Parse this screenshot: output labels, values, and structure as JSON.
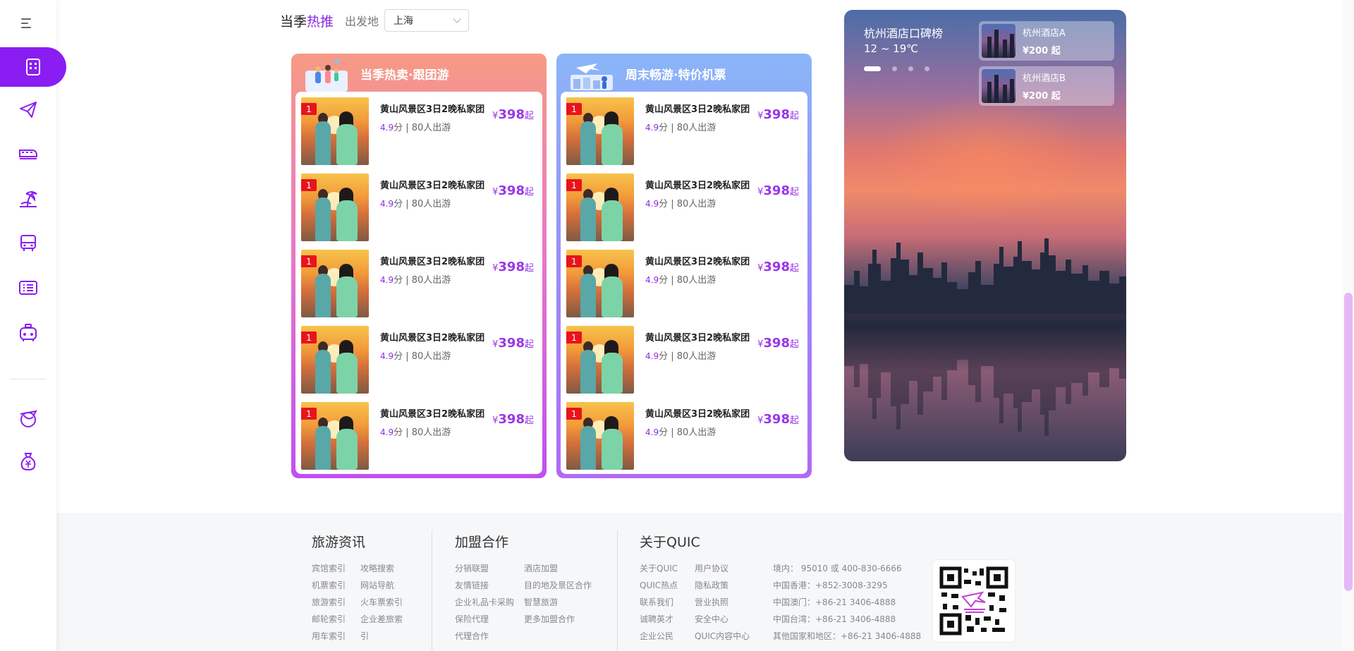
{
  "nav": {
    "items": [
      {
        "icon": "hotel-icon",
        "active": true
      },
      {
        "icon": "flight-icon",
        "active": false
      },
      {
        "icon": "train-icon",
        "active": false
      },
      {
        "icon": "vacation-icon",
        "active": false
      },
      {
        "icon": "bus-icon",
        "active": false
      },
      {
        "icon": "ticket-list-icon",
        "active": false
      },
      {
        "icon": "taxi-icon",
        "active": false
      },
      {
        "icon": "visa-icon",
        "active": false
      },
      {
        "icon": "money-bag-icon",
        "active": false
      }
    ],
    "accent": "#8a1df2"
  },
  "section": {
    "title_prefix": "当季",
    "title_highlight": "热推",
    "depart_label": "出发地",
    "depart_value": "上海"
  },
  "cards": [
    {
      "title": "当季热卖·跟团游",
      "items": [
        {
          "rank": "1",
          "name": "黄山风景区3日2晚私家团",
          "score": "4.9",
          "score_unit": "分",
          "travelers": "| 80人出游",
          "currency": "¥",
          "price": "398",
          "price_suffix": "起"
        },
        {
          "rank": "1",
          "name": "黄山风景区3日2晚私家团",
          "score": "4.9",
          "score_unit": "分",
          "travelers": "| 80人出游",
          "currency": "¥",
          "price": "398",
          "price_suffix": "起"
        },
        {
          "rank": "1",
          "name": "黄山风景区3日2晚私家团",
          "score": "4.9",
          "score_unit": "分",
          "travelers": "| 80人出游",
          "currency": "¥",
          "price": "398",
          "price_suffix": "起"
        },
        {
          "rank": "1",
          "name": "黄山风景区3日2晚私家团",
          "score": "4.9",
          "score_unit": "分",
          "travelers": "| 80人出游",
          "currency": "¥",
          "price": "398",
          "price_suffix": "起"
        },
        {
          "rank": "1",
          "name": "黄山风景区3日2晚私家团",
          "score": "4.9",
          "score_unit": "分",
          "travelers": "| 80人出游",
          "currency": "¥",
          "price": "398",
          "price_suffix": "起"
        }
      ]
    },
    {
      "title": "周末畅游·特价机票",
      "items": [
        {
          "rank": "1",
          "name": "黄山风景区3日2晚私家团",
          "score": "4.9",
          "score_unit": "分",
          "travelers": "| 80人出游",
          "currency": "¥",
          "price": "398",
          "price_suffix": "起"
        },
        {
          "rank": "1",
          "name": "黄山风景区3日2晚私家团",
          "score": "4.9",
          "score_unit": "分",
          "travelers": "| 80人出游",
          "currency": "¥",
          "price": "398",
          "price_suffix": "起"
        },
        {
          "rank": "1",
          "name": "黄山风景区3日2晚私家团",
          "score": "4.9",
          "score_unit": "分",
          "travelers": "| 80人出游",
          "currency": "¥",
          "price": "398",
          "price_suffix": "起"
        },
        {
          "rank": "1",
          "name": "黄山风景区3日2晚私家团",
          "score": "4.9",
          "score_unit": "分",
          "travelers": "| 80人出游",
          "currency": "¥",
          "price": "398",
          "price_suffix": "起"
        },
        {
          "rank": "1",
          "name": "黄山风景区3日2晚私家团",
          "score": "4.9",
          "score_unit": "分",
          "travelers": "| 80人出游",
          "currency": "¥",
          "price": "398",
          "price_suffix": "起"
        }
      ]
    }
  ],
  "hotel_banner": {
    "title": "杭州酒店口碑榜",
    "temperature": "12 ~ 19℃",
    "slides": 4,
    "active_slide": 1,
    "hotels": [
      {
        "name": "杭州酒店A",
        "price": "¥200 起"
      },
      {
        "name": "杭州酒店B",
        "price": "¥200 起"
      }
    ]
  },
  "footer": {
    "travel_info": {
      "title": "旅游资讯",
      "col1": [
        "宾馆索引",
        "机票索引",
        "旅游索引",
        "邮轮索引",
        "用车索引"
      ],
      "col2": [
        "攻略搜索",
        "网站导航",
        "火车票索引",
        "企业差旅索",
        "引"
      ]
    },
    "partner": {
      "title": "加盟合作",
      "col1": [
        "分销联盟",
        "友情链接",
        "企业礼品卡采购",
        "保险代理",
        "代理合作"
      ],
      "col2": [
        "酒店加盟",
        "目的地及景区合作",
        "智慧旅游",
        "更多加盟合作"
      ]
    },
    "about": {
      "title": "关于QUIC",
      "col1": [
        "关于QUIC",
        "QUIC热点",
        "联系我们",
        "诚聘英才",
        "企业公民"
      ],
      "col2": [
        "用户协议",
        "隐私政策",
        "营业执照",
        "安全中心",
        "QUIC内容中心"
      ],
      "contacts": [
        "境内：  95010 或 400-830-6666",
        "中国香港：+852-3008-3295",
        "中国澳门：+86-21 3406-4888",
        "中国台湾：+86-21 3406-4888",
        "其他国家和地区：+86-21 3406-4888"
      ]
    }
  }
}
